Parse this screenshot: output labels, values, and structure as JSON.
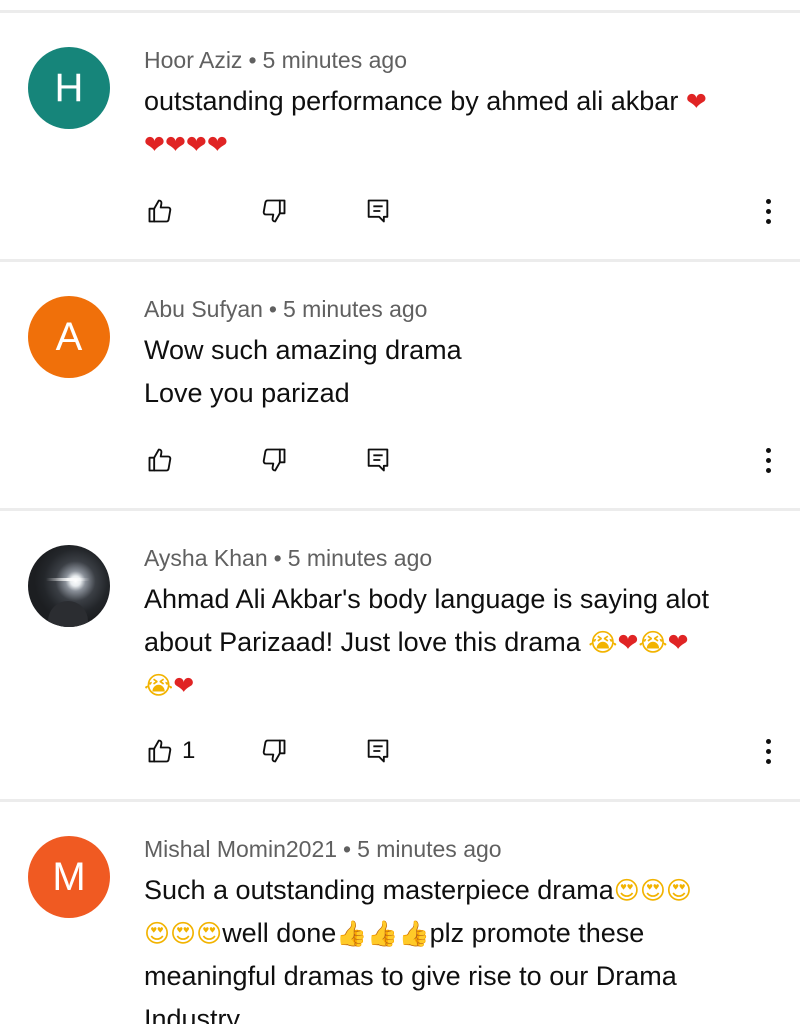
{
  "comments": [
    {
      "avatar_letter": "H",
      "avatar_color": "#16857a",
      "author": "Hoor Aziz",
      "separator": "•",
      "time": "5 minutes ago",
      "text_lines": [
        "outstanding performance by ahmed ali akbar"
      ],
      "emoji_line1": "❤",
      "emoji_line2": "❤❤❤❤",
      "likes": ""
    },
    {
      "avatar_letter": "A",
      "avatar_color": "#f0700a",
      "author": "Abu Sufyan",
      "separator": "•",
      "time": "5 minutes ago",
      "text_line1": "Wow such amazing drama",
      "text_line2": "Love you parizad",
      "likes": ""
    },
    {
      "avatar_letter": "",
      "avatar_kind": "photo",
      "author": "Aysha Khan",
      "separator": "•",
      "time": "5 minutes ago",
      "text_line1": "Ahmad Ali Akbar's body language is saying alot",
      "text_line2": "about Parizaad! Just love this drama",
      "emoji_seq_a": [
        "😭",
        "❤",
        "😭",
        "❤"
      ],
      "emoji_seq_b": [
        "😭",
        "❤"
      ],
      "likes": "1"
    },
    {
      "avatar_letter": "M",
      "avatar_color": "#f05a22",
      "author": "Mishal Momin2021",
      "separator": "•",
      "time": "5 minutes ago",
      "text_part1": "Such a outstanding masterpiece drama",
      "emoji_eyes_a": "😍😍😍",
      "emoji_eyes_b": "😍😍😍",
      "text_part2": "well done",
      "emoji_thumbs": "👍👍👍",
      "text_part3": "plz promote these",
      "text_line3": "meaningful dramas to give rise to our Drama",
      "text_line4": "Industry"
    }
  ],
  "icons": {
    "like": "thumb-up-icon",
    "dislike": "thumb-down-icon",
    "reply": "reply-comment-icon",
    "more": "more-vertical-icon"
  }
}
